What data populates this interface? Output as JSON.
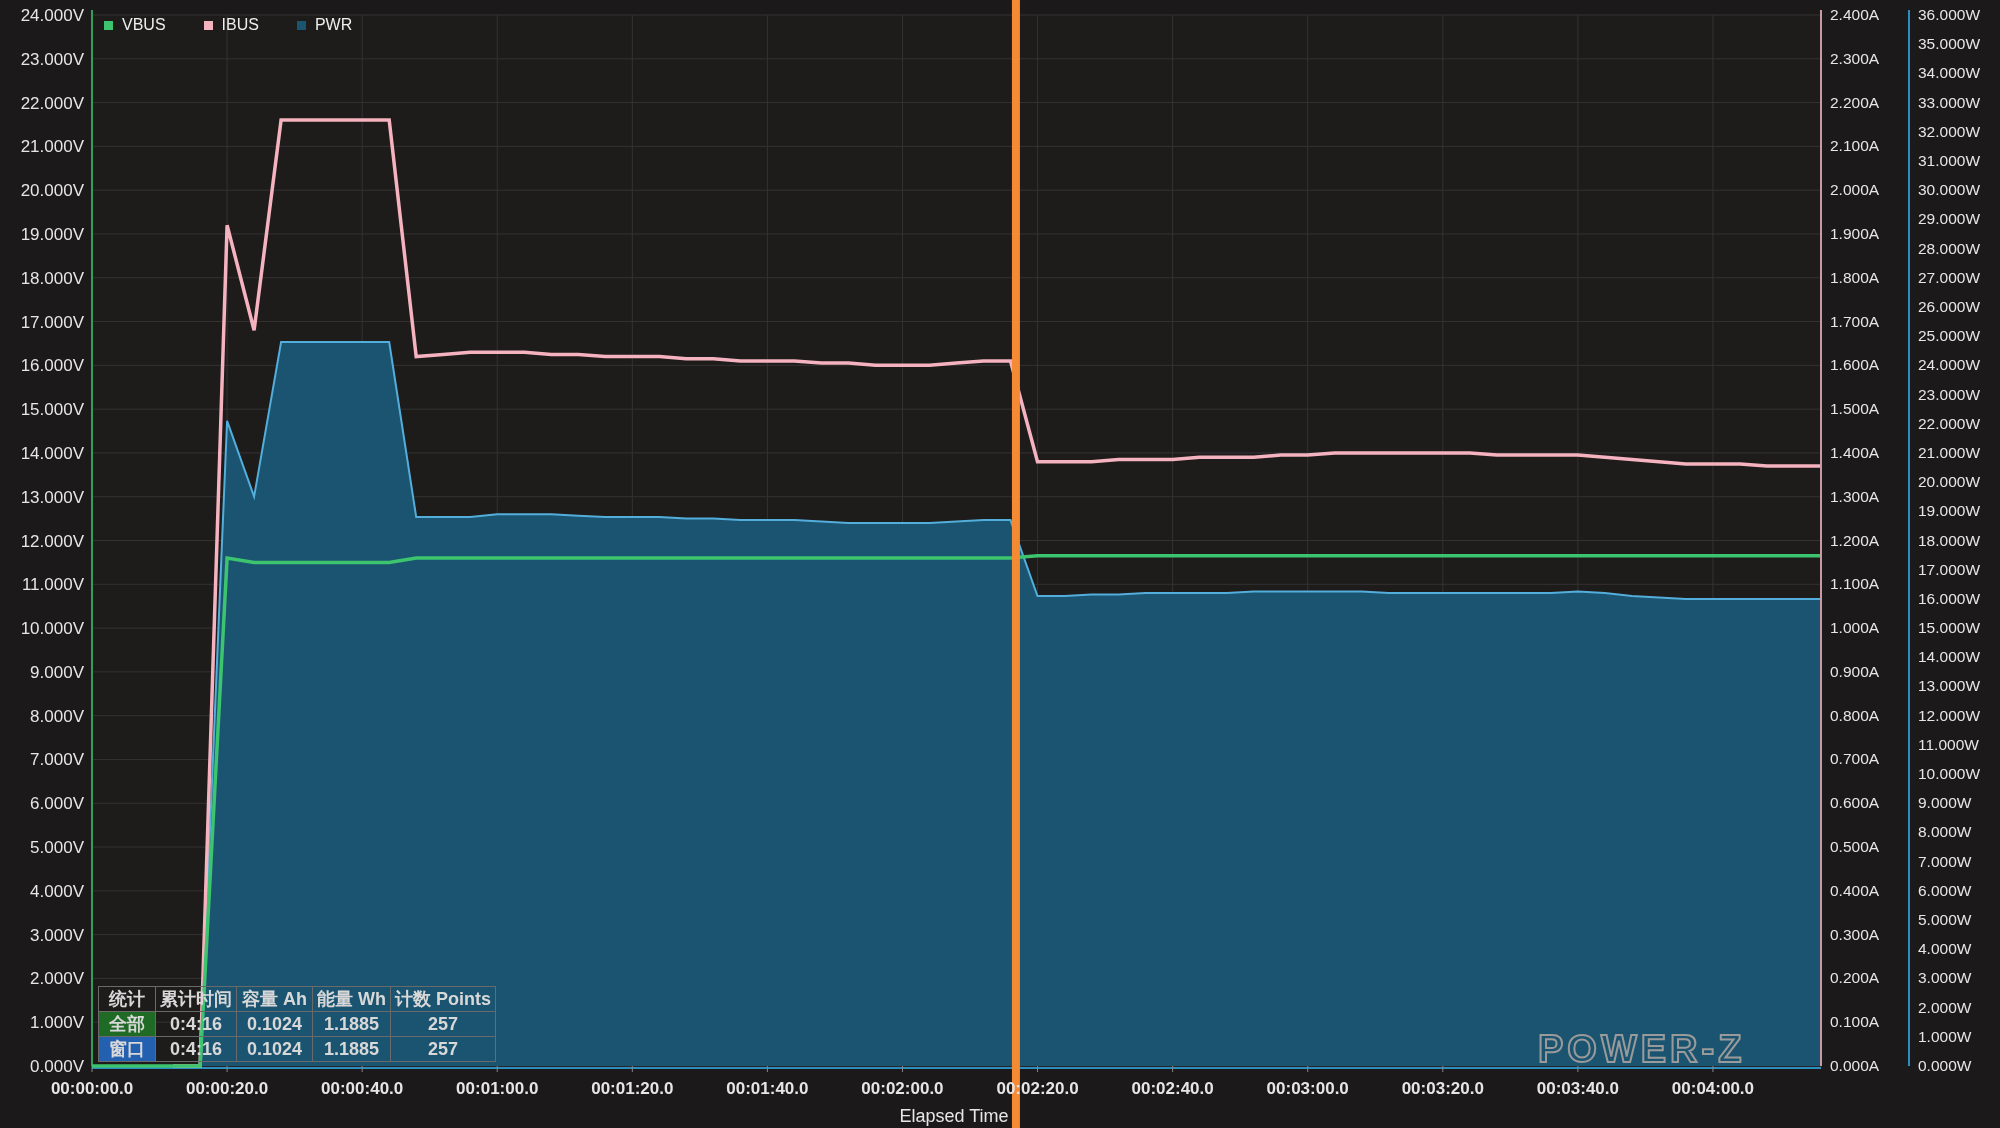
{
  "chart_data": {
    "type": "line",
    "xlabel": "Elapsed Time",
    "categories": [
      "00:00:00.0",
      null,
      null,
      null,
      null,
      "00:00:20.0",
      null,
      null,
      null,
      null,
      "00:00:40.0",
      null,
      null,
      null,
      null,
      "00:01:00.0",
      null,
      null,
      null,
      null,
      "00:01:20.0",
      null,
      null,
      null,
      null,
      "00:01:40.0",
      null,
      null,
      null,
      null,
      "00:02:00.0",
      null,
      null,
      null,
      null,
      "00:02:20.0",
      null,
      null,
      null,
      null,
      "00:02:40.0",
      null,
      null,
      null,
      null,
      "00:03:00.0",
      null,
      null,
      null,
      null,
      "00:03:20.0",
      null,
      null,
      null,
      null,
      "00:03:40.0",
      null,
      null,
      null,
      null,
      "00:04:00.0",
      null,
      null,
      null,
      null
    ],
    "series": [
      {
        "name": "VBUS",
        "color": "#3cc46e",
        "values": [
          0,
          0,
          0,
          0,
          0,
          11.6,
          11.5,
          11.5,
          11.5,
          11.5,
          11.5,
          11.5,
          11.6,
          11.6,
          11.6,
          11.6,
          11.6,
          11.6,
          11.6,
          11.6,
          11.6,
          11.6,
          11.6,
          11.6,
          11.6,
          11.6,
          11.6,
          11.6,
          11.6,
          11.6,
          11.6,
          11.6,
          11.6,
          11.6,
          11.6,
          11.65,
          11.65,
          11.65,
          11.65,
          11.65,
          11.65,
          11.65,
          11.65,
          11.65,
          11.65,
          11.65,
          11.65,
          11.65,
          11.65,
          11.65,
          11.65,
          11.65,
          11.65,
          11.65,
          11.65,
          11.65,
          11.65,
          11.65,
          11.65,
          11.65,
          11.65,
          11.65,
          11.65,
          11.65,
          11.65
        ]
      },
      {
        "name": "IBUS",
        "color": "#f5b3c0",
        "axis": "y2",
        "values": [
          null,
          null,
          null,
          0,
          0,
          1.92,
          1.68,
          2.16,
          2.16,
          2.16,
          2.16,
          2.16,
          1.62,
          1.625,
          1.63,
          1.63,
          1.63,
          1.625,
          1.625,
          1.62,
          1.62,
          1.62,
          1.615,
          1.615,
          1.61,
          1.61,
          1.61,
          1.605,
          1.605,
          1.6,
          1.6,
          1.6,
          1.605,
          1.61,
          1.61,
          1.38,
          1.38,
          1.38,
          1.385,
          1.385,
          1.385,
          1.39,
          1.39,
          1.39,
          1.395,
          1.395,
          1.4,
          1.4,
          1.4,
          1.4,
          1.4,
          1.4,
          1.395,
          1.395,
          1.395,
          1.395,
          1.39,
          1.385,
          1.38,
          1.375,
          1.375,
          1.375,
          1.37,
          1.37,
          1.37
        ]
      },
      {
        "name": "PWR",
        "color": "#1b5470",
        "axis": "y3",
        "type": "area",
        "values": [
          null,
          null,
          null,
          null,
          0,
          22.1,
          19.5,
          24.8,
          24.8,
          24.8,
          24.8,
          24.8,
          18.8,
          18.8,
          18.8,
          18.9,
          18.9,
          18.9,
          18.85,
          18.8,
          18.8,
          18.8,
          18.75,
          18.75,
          18.7,
          18.7,
          18.7,
          18.65,
          18.6,
          18.6,
          18.6,
          18.6,
          18.65,
          18.7,
          18.7,
          16.1,
          16.1,
          16.15,
          16.15,
          16.2,
          16.2,
          16.2,
          16.2,
          16.25,
          16.25,
          16.25,
          16.25,
          16.25,
          16.2,
          16.2,
          16.2,
          16.2,
          16.2,
          16.2,
          16.2,
          16.25,
          16.2,
          16.1,
          16.05,
          16,
          16,
          16,
          16,
          16,
          16
        ]
      }
    ],
    "ylim": [
      0,
      24
    ],
    "yticks": [
      {
        "value": 0,
        "label": "0.000V"
      },
      {
        "value": 1,
        "label": "1.000V"
      },
      {
        "value": 2,
        "label": "2.000V"
      },
      {
        "value": 3,
        "label": "3.000V"
      },
      {
        "value": 4,
        "label": "4.000V"
      },
      {
        "value": 5,
        "label": "5.000V"
      },
      {
        "value": 6,
        "label": "6.000V"
      },
      {
        "value": 7,
        "label": "7.000V"
      },
      {
        "value": 8,
        "label": "8.000V"
      },
      {
        "value": 9,
        "label": "9.000V"
      },
      {
        "value": 10,
        "label": "10.000V"
      },
      {
        "value": 11,
        "label": "11.000V"
      },
      {
        "value": 12,
        "label": "12.000V"
      },
      {
        "value": 13,
        "label": "13.000V"
      },
      {
        "value": 14,
        "label": "14.000V"
      },
      {
        "value": 15,
        "label": "15.000V"
      },
      {
        "value": 16,
        "label": "16.000V"
      },
      {
        "value": 17,
        "label": "17.000V"
      },
      {
        "value": 18,
        "label": "18.000V"
      },
      {
        "value": 19,
        "label": "19.000V"
      },
      {
        "value": 20,
        "label": "20.000V"
      },
      {
        "value": 21,
        "label": "21.000V"
      },
      {
        "value": 22,
        "label": "22.000V"
      },
      {
        "value": 23,
        "label": "23.000V"
      },
      {
        "value": 24,
        "label": "24.000V"
      }
    ],
    "y2lim": [
      0,
      2.4
    ],
    "y2ticks": [
      {
        "value": 0,
        "label": "0.000A"
      },
      {
        "value": 0.1,
        "label": "0.100A"
      },
      {
        "value": 0.2,
        "label": "0.200A"
      },
      {
        "value": 0.3,
        "label": "0.300A"
      },
      {
        "value": 0.4,
        "label": "0.400A"
      },
      {
        "value": 0.5,
        "label": "0.500A"
      },
      {
        "value": 0.6,
        "label": "0.600A"
      },
      {
        "value": 0.7,
        "label": "0.700A"
      },
      {
        "value": 0.8,
        "label": "0.800A"
      },
      {
        "value": 0.9,
        "label": "0.900A"
      },
      {
        "value": 1,
        "label": "1.000A"
      },
      {
        "value": 1.1,
        "label": "1.100A"
      },
      {
        "value": 1.2,
        "label": "1.200A"
      },
      {
        "value": 1.3,
        "label": "1.300A"
      },
      {
        "value": 1.4,
        "label": "1.400A"
      },
      {
        "value": 1.5,
        "label": "1.500A"
      },
      {
        "value": 1.6,
        "label": "1.600A"
      },
      {
        "value": 1.7,
        "label": "1.700A"
      },
      {
        "value": 1.8,
        "label": "1.800A"
      },
      {
        "value": 1.9,
        "label": "1.900A"
      },
      {
        "value": 2,
        "label": "2.000A"
      },
      {
        "value": 2.1,
        "label": "2.100A"
      },
      {
        "value": 2.2,
        "label": "2.200A"
      },
      {
        "value": 2.3,
        "label": "2.300A"
      },
      {
        "value": 2.4,
        "label": "2.400A"
      }
    ],
    "y3lim": [
      0,
      36
    ],
    "y3ticks": [
      {
        "value": 0,
        "label": "0.000W"
      },
      {
        "value": 1,
        "label": "1.000W"
      },
      {
        "value": 2,
        "label": "2.000W"
      },
      {
        "value": 3,
        "label": "3.000W"
      },
      {
        "value": 4,
        "label": "4.000W"
      },
      {
        "value": 5,
        "label": "5.000W"
      },
      {
        "value": 6,
        "label": "6.000W"
      },
      {
        "value": 7,
        "label": "7.000W"
      },
      {
        "value": 8,
        "label": "8.000W"
      },
      {
        "value": 9,
        "label": "9.000W"
      },
      {
        "value": 10,
        "label": "10.000W"
      },
      {
        "value": 11,
        "label": "11.000W"
      },
      {
        "value": 12,
        "label": "12.000W"
      },
      {
        "value": 13,
        "label": "13.000W"
      },
      {
        "value": 14,
        "label": "14.000W"
      },
      {
        "value": 15,
        "label": "15.000W"
      },
      {
        "value": 16,
        "label": "16.000W"
      },
      {
        "value": 17,
        "label": "17.000W"
      },
      {
        "value": 18,
        "label": "18.000W"
      },
      {
        "value": 19,
        "label": "19.000W"
      },
      {
        "value": 20,
        "label": "20.000W"
      },
      {
        "value": 21,
        "label": "21.000W"
      },
      {
        "value": 22,
        "label": "22.000W"
      },
      {
        "value": 23,
        "label": "23.000W"
      },
      {
        "value": 24,
        "label": "24.000W"
      },
      {
        "value": 25,
        "label": "25.000W"
      },
      {
        "value": 26,
        "label": "26.000W"
      },
      {
        "value": 27,
        "label": "27.000W"
      },
      {
        "value": 28,
        "label": "28.000W"
      },
      {
        "value": 29,
        "label": "29.000W"
      },
      {
        "value": 30,
        "label": "30.000W"
      },
      {
        "value": 31,
        "label": "31.000W"
      },
      {
        "value": 32,
        "label": "32.000W"
      },
      {
        "value": 33,
        "label": "33.000W"
      },
      {
        "value": 34,
        "label": "34.000W"
      },
      {
        "value": 35,
        "label": "35.000W"
      },
      {
        "value": 36,
        "label": "36.000W"
      }
    ],
    "grid": true
  },
  "stats": {
    "columns": [
      "统计",
      "累计时间",
      "容量 Ah",
      "能量 Wh",
      "计数 Points"
    ],
    "rows": [
      {
        "color": "#1f6b26",
        "cells": [
          "全部",
          "0:4:16",
          "0.1024",
          "1.1885",
          "257"
        ]
      },
      {
        "color": "#2360b0",
        "cells": [
          "窗口",
          "0:4:16",
          "0.1024",
          "1.1885",
          "257"
        ]
      }
    ]
  },
  "logo": "POWER-Z"
}
